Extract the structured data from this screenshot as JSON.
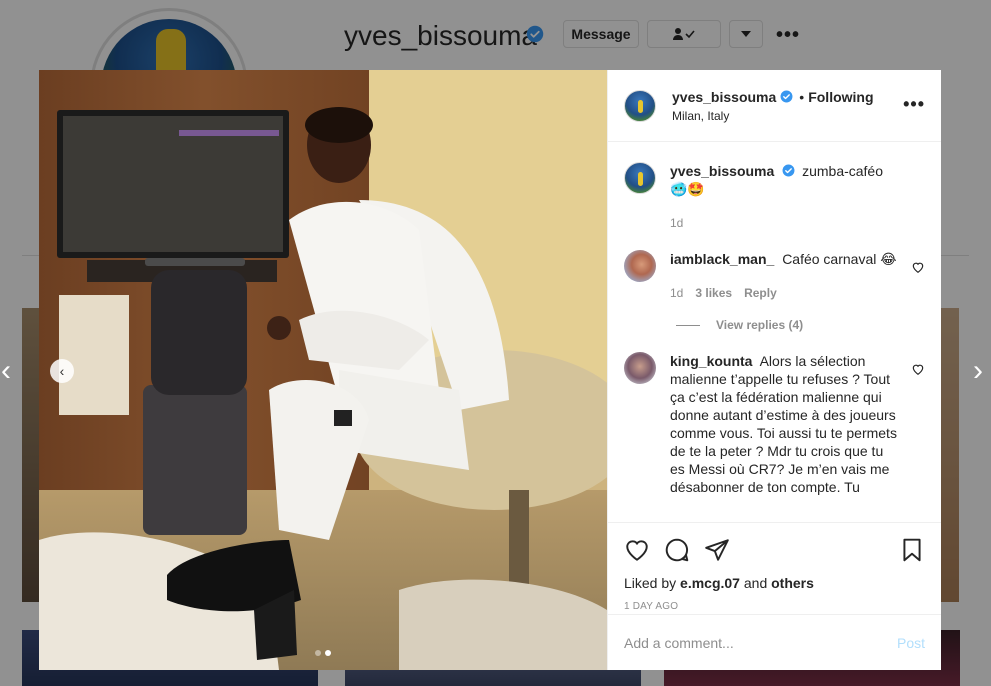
{
  "background_profile": {
    "username": "yves_bissouma",
    "message_label": "Message",
    "following_icon": "user-check-icon",
    "dropdown_icon": "chevron-down-icon",
    "more_label": "•••"
  },
  "modal": {
    "prev_arrow": "‹",
    "next_arrow": "›",
    "carousel": {
      "current": 2,
      "total": 2,
      "prev_label": "‹"
    },
    "header": {
      "username": "yves_bissouma",
      "bullet": "•",
      "following": "Following",
      "location": "Milan, Italy",
      "options_label": "•••"
    },
    "caption": {
      "username": "yves_bissouma",
      "text": "zumba-caféo 🥶🤩",
      "time": "1d"
    },
    "comments": [
      {
        "username": "iamblack_man_",
        "text": "Caféo carnaval 😂",
        "time": "1d",
        "likes": "3 likes",
        "reply": "Reply",
        "view_replies": "View replies (4)"
      },
      {
        "username": "king_kounta",
        "text": "Alors la sélection malienne t’appelle tu refuses ? Tout ça c’est la fédération malienne qui donne autant d’estime à des joueurs comme vous. Toi aussi tu te permets de te la peter ? Mdr tu crois que tu es Messi où CR7? Je m’en vais me désabonner de ton compte. Tu"
      }
    ],
    "liked_by": {
      "prefix": "Liked by",
      "user": "e.mcg.07",
      "and": "and",
      "others": "others"
    },
    "timestamp": "1 DAY AGO",
    "comment_placeholder": "Add a comment...",
    "post_label": "Post"
  },
  "colors": {
    "verified_blue": "#3897f0",
    "post_disabled": "#b2dffc",
    "meta_gray": "#8e8e8e"
  }
}
